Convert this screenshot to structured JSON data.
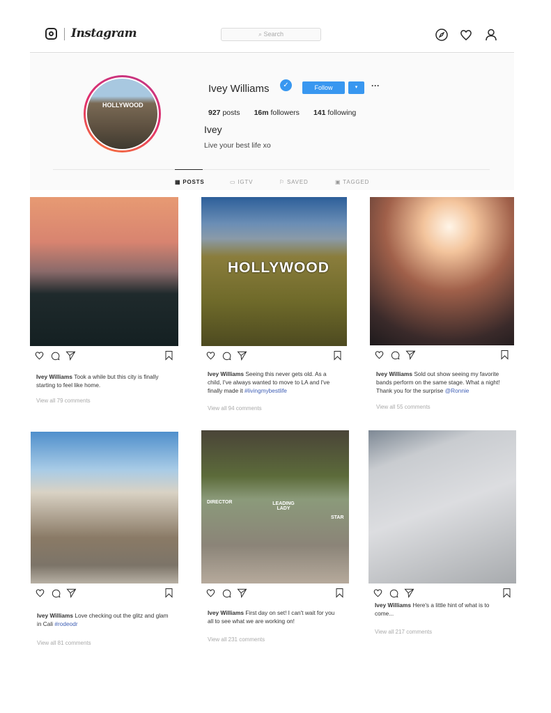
{
  "header": {
    "brand": "Instagram",
    "search_placeholder": "Search",
    "icons": [
      "instagram-glyph-icon",
      "compass-icon",
      "heart-icon",
      "user-icon"
    ]
  },
  "profile": {
    "username": "Ivey Williams",
    "verified": true,
    "follow_label": "Follow",
    "dropdown_icon": "▾",
    "more_icon": "···",
    "stats": [
      {
        "value": "927",
        "label": "posts"
      },
      {
        "value": "16m",
        "label": "followers"
      },
      {
        "value": "141",
        "label": "following"
      }
    ],
    "full_name": "Ivey",
    "bio": "Live your best life xo",
    "avatar_text": "HOLLYWOOD"
  },
  "tabs": [
    {
      "label": "POSTS",
      "active": true
    },
    {
      "label": "IGTV"
    },
    {
      "label": "SAVED"
    },
    {
      "label": "TAGGED"
    }
  ],
  "colors": {
    "accent": "#3897f0",
    "link": "#3f5fb5"
  },
  "posts": [
    {
      "user": "Ivey Williams",
      "caption": "Took a while but this city is finally starting to feel like home.",
      "tag": "",
      "comments": "View all 79 comments"
    },
    {
      "user": "Ivey Williams",
      "caption": "Seeing this never gets old. As a child, I've always wanted to move to LA and I've finally made it",
      "tag": "#livingmybestlife",
      "comments": "View all 94 comments",
      "photo_text": "HOLLYWOOD"
    },
    {
      "user": "Ivey Williams",
      "caption": "Sold out show seeing my favorite bands perform on the same stage. What a night! Thank you for the surprise",
      "tag": "@Ronnie",
      "comments": "View all 55 comments"
    },
    {
      "user": "Ivey Williams",
      "caption": "Love checking out the glitz and glam in Cali",
      "tag": "#rodeodr",
      "comments": "View all 81 comments"
    },
    {
      "user": "Ivey Williams",
      "caption": "First day on set! I can't wait for you all to see what we are working on!",
      "tag": "",
      "comments": "View all 231 comments",
      "photo_text": [
        "DIRECTOR",
        "LEADING LADY",
        "STAR"
      ]
    },
    {
      "user": "Ivey Williams",
      "caption": "Here's a little hint of what is to come...",
      "tag": "",
      "comments": "View all 217 comments"
    }
  ]
}
